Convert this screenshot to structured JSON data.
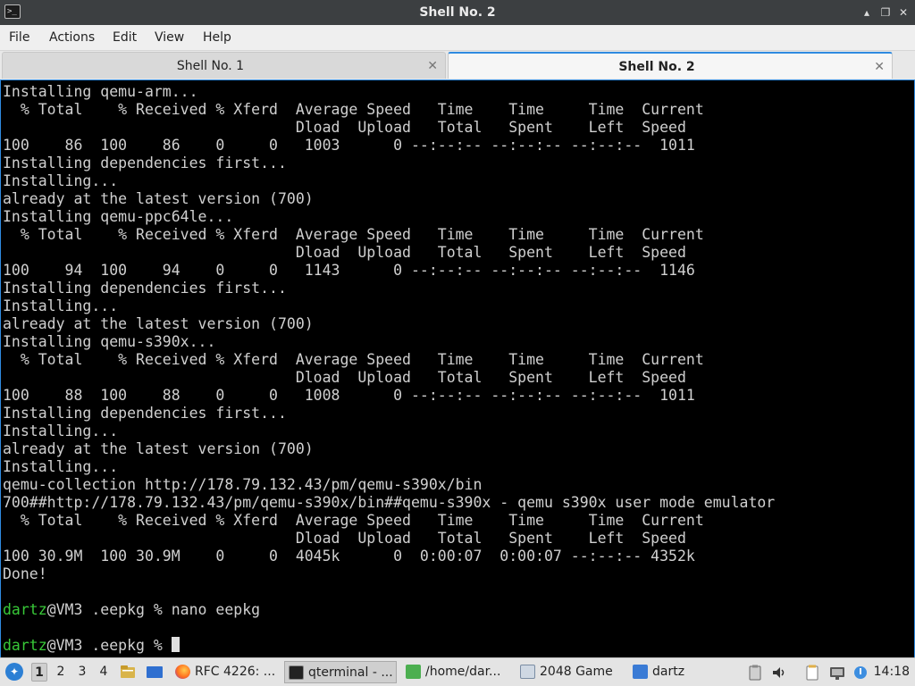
{
  "window": {
    "title": "Shell No. 2",
    "icon": "terminal-icon",
    "controls": {
      "minimize": "▴",
      "restore": "❐",
      "close": "✕"
    }
  },
  "menubar": {
    "items": [
      "File",
      "Actions",
      "Edit",
      "View",
      "Help"
    ]
  },
  "tabs": [
    {
      "label": "Shell No. 1",
      "active": false,
      "close": "✕"
    },
    {
      "label": "Shell No. 2",
      "active": true,
      "close": "✕"
    }
  ],
  "terminal": {
    "lines": [
      "Installing qemu-arm...",
      "  % Total    % Received % Xferd  Average Speed   Time    Time     Time  Current",
      "                                 Dload  Upload   Total   Spent    Left  Speed",
      "100    86  100    86    0     0   1003      0 --:--:-- --:--:-- --:--:--  1011",
      "Installing dependencies first...",
      "Installing...",
      "already at the latest version (700)",
      "Installing qemu-ppc64le...",
      "  % Total    % Received % Xferd  Average Speed   Time    Time     Time  Current",
      "                                 Dload  Upload   Total   Spent    Left  Speed",
      "100    94  100    94    0     0   1143      0 --:--:-- --:--:-- --:--:--  1146",
      "Installing dependencies first...",
      "Installing...",
      "already at the latest version (700)",
      "Installing qemu-s390x...",
      "  % Total    % Received % Xferd  Average Speed   Time    Time     Time  Current",
      "                                 Dload  Upload   Total   Spent    Left  Speed",
      "100    88  100    88    0     0   1008      0 --:--:-- --:--:-- --:--:--  1011",
      "Installing dependencies first...",
      "Installing...",
      "already at the latest version (700)",
      "Installing...",
      "qemu-collection http://178.79.132.43/pm/qemu-s390x/bin",
      "700##http://178.79.132.43/pm/qemu-s390x/bin##qemu-s390x - qemu s390x user mode emulator",
      "  % Total    % Received % Xferd  Average Speed   Time    Time     Time  Current",
      "                                 Dload  Upload   Total   Spent    Left  Speed",
      "100 30.9M  100 30.9M    0     0  4045k      0  0:00:07  0:00:07 --:--:-- 4352k",
      "Done!",
      ""
    ],
    "prompt_lines": [
      {
        "user": "dartz",
        "rest": "@VM3 .eepkg % nano eepkg"
      },
      {
        "user": "",
        "rest": ""
      },
      {
        "user": "dartz",
        "rest": "@VM3 .eepkg % "
      }
    ],
    "colors": {
      "background": "#000000",
      "text": "#d0d0d0",
      "user": "#38c938"
    }
  },
  "taskbar": {
    "start_icon": "start-menu-icon",
    "workspaces": [
      "1",
      "2",
      "3",
      "4"
    ],
    "active_workspace": "1",
    "tasks": [
      {
        "label": "RFC 4226: ...",
        "icon": "firefox-icon"
      },
      {
        "label": "qterminal - ...",
        "icon": "terminal-icon",
        "active": true
      },
      {
        "label": "/home/dar...",
        "icon": "text-editor-icon"
      },
      {
        "label": "2048 Game",
        "icon": "window-icon"
      },
      {
        "label": "dartz",
        "icon": "folder-icon"
      }
    ],
    "clock": "14:18"
  }
}
